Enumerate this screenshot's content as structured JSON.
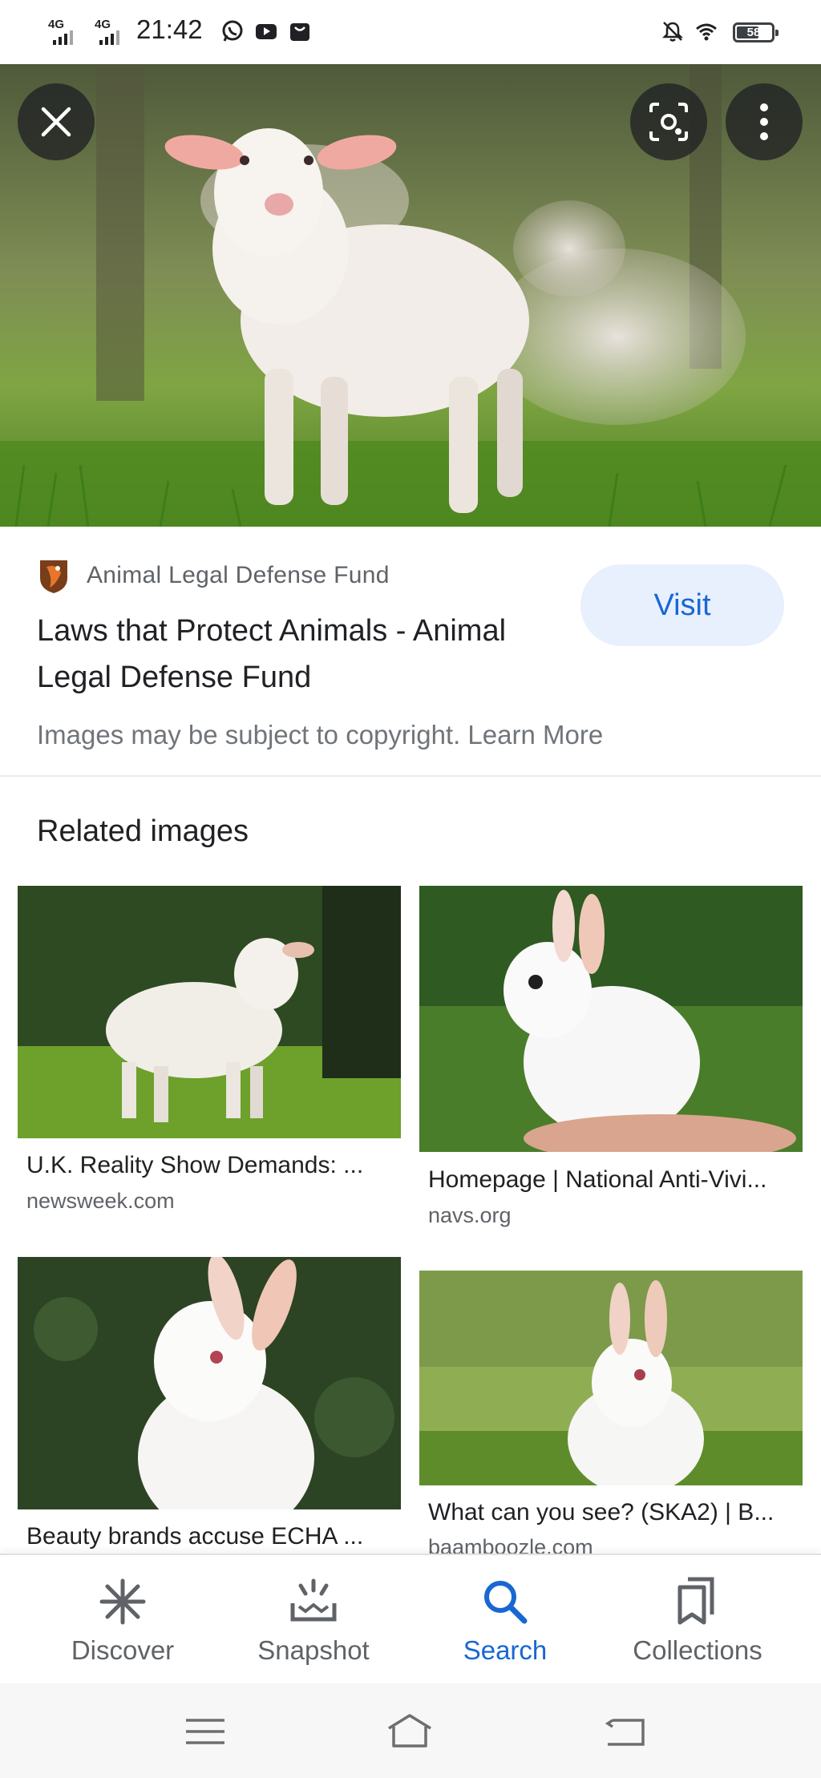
{
  "status_bar": {
    "network_1": "4G",
    "network_2": "4G",
    "time": "21:42",
    "battery": "58",
    "battery_level": 0.58,
    "icons": [
      "whatsapp-icon",
      "youtube-icon",
      "shopping-icon",
      "mute-icon",
      "wifi-icon",
      "battery-icon"
    ]
  },
  "viewer": {
    "close_icon": "close-icon",
    "lens_icon": "lens-icon",
    "more_icon": "more-vert-icon"
  },
  "result": {
    "source_name": "Animal Legal Defense Fund",
    "title": "Laws that Protect Animals - Animal Legal Defense Fund",
    "visit_label": "Visit",
    "copyright_text": "Images may be subject to copyright. Learn More"
  },
  "related": {
    "heading": "Related images",
    "items": [
      {
        "title": "U.K. Reality Show Demands: ...",
        "domain": "newsweek.com"
      },
      {
        "title": "Homepage | National Anti-Vivi...",
        "domain": "navs.org"
      },
      {
        "title": "Beauty brands accuse ECHA ...",
        "domain": ""
      },
      {
        "title": "What can you see? (SKA2) | B...",
        "domain": "baamboozle.com"
      }
    ]
  },
  "bottom_nav": {
    "items": [
      {
        "label": "Discover",
        "icon": "asterisk-icon"
      },
      {
        "label": "Snapshot",
        "icon": "snapshot-icon"
      },
      {
        "label": "Search",
        "icon": "search-icon"
      },
      {
        "label": "Collections",
        "icon": "collections-icon"
      }
    ],
    "active": "Search"
  },
  "colors": {
    "accent": "#1967d2",
    "visit_bg": "#e8f0fe",
    "text_secondary": "#5f6368"
  }
}
